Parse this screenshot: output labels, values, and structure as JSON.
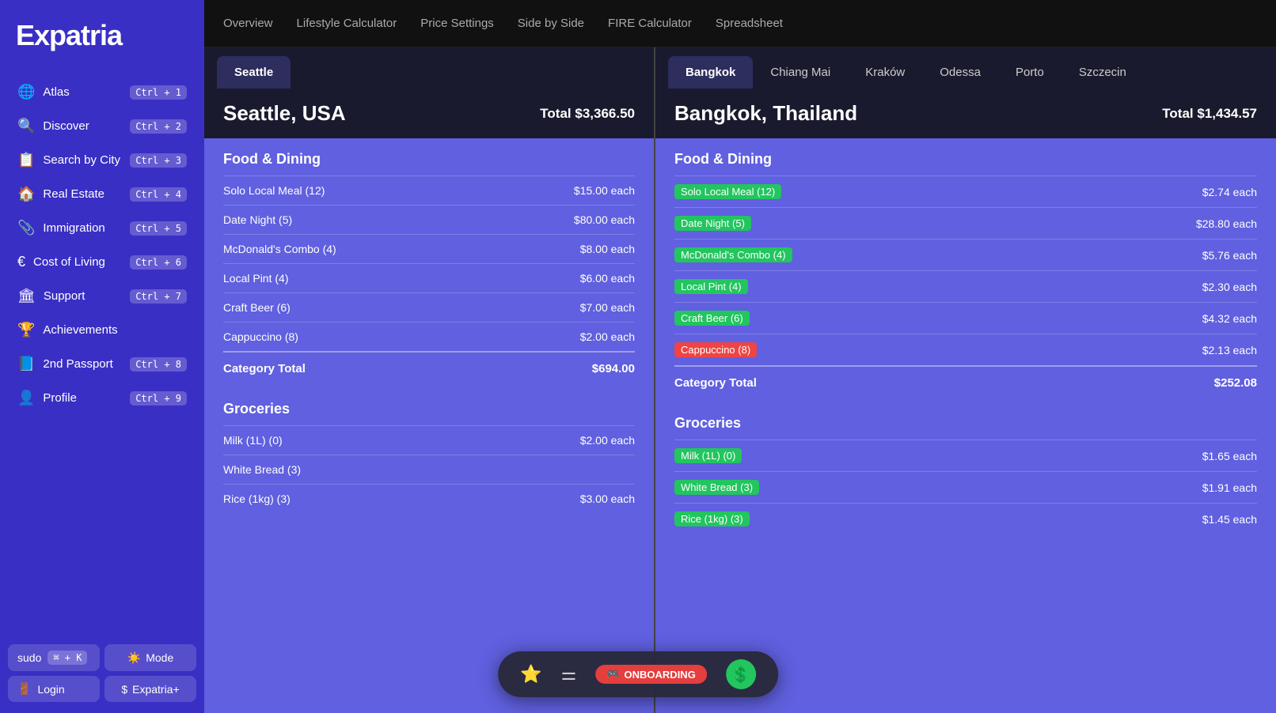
{
  "sidebar": {
    "logo": "Expatria",
    "items": [
      {
        "id": "atlas",
        "icon": "🌐",
        "label": "Atlas",
        "shortcut": "Ctrl + 1"
      },
      {
        "id": "discover",
        "icon": "🔍",
        "label": "Discover",
        "shortcut": "Ctrl + 2"
      },
      {
        "id": "search-by-city",
        "icon": "📋",
        "label": "Search by City",
        "shortcut": "Ctrl + 3"
      },
      {
        "id": "real-estate",
        "icon": "🏠",
        "label": "Real Estate",
        "shortcut": "Ctrl + 4"
      },
      {
        "id": "immigration",
        "icon": "📎",
        "label": "Immigration",
        "shortcut": "Ctrl + 5"
      },
      {
        "id": "cost-of-living",
        "icon": "€",
        "label": "Cost of Living",
        "shortcut": "Ctrl + 6"
      },
      {
        "id": "support",
        "icon": "🏛",
        "label": "Support",
        "shortcut": "Ctrl + 7"
      },
      {
        "id": "achievements",
        "icon": "🏆",
        "label": "Achievements",
        "shortcut": ""
      },
      {
        "id": "2nd-passport",
        "icon": "📘",
        "label": "2nd Passport",
        "shortcut": "Ctrl + 8"
      },
      {
        "id": "profile",
        "icon": "👤",
        "label": "Profile",
        "shortcut": "Ctrl + 9"
      }
    ],
    "sudo_label": "sudo",
    "sudo_shortcut": "⌘ + K",
    "mode_label": "Mode",
    "login_label": "Login",
    "expatria_plus_label": "Expatria+"
  },
  "top_nav": {
    "items": [
      {
        "id": "overview",
        "label": "Overview"
      },
      {
        "id": "lifestyle-calc",
        "label": "Lifestyle Calculator"
      },
      {
        "id": "price-settings",
        "label": "Price Settings"
      },
      {
        "id": "side-by-side",
        "label": "Side by Side"
      },
      {
        "id": "fire-calc",
        "label": "FIRE Calculator"
      },
      {
        "id": "spreadsheet",
        "label": "Spreadsheet"
      }
    ]
  },
  "left_panel": {
    "tab_label": "Seattle",
    "city_name": "Seattle, USA",
    "city_total": "Total $3,366.50",
    "sections": [
      {
        "title": "Food & Dining",
        "rows": [
          {
            "label": "Solo Local Meal (12)",
            "value": "$15.00 each",
            "tag": null
          },
          {
            "label": "Date Night (5)",
            "value": "$80.00 each",
            "tag": null
          },
          {
            "label": "McDonald's Combo (4)",
            "value": "$8.00 each",
            "tag": null
          },
          {
            "label": "Local Pint (4)",
            "value": "$6.00 each",
            "tag": null
          },
          {
            "label": "Craft Beer (6)",
            "value": "$7.00 each",
            "tag": null
          },
          {
            "label": "Cappuccino (8)",
            "value": "$2.00 each",
            "tag": null
          }
        ],
        "category_total_label": "Category Total",
        "category_total_value": "$694.00"
      },
      {
        "title": "Groceries",
        "rows": [
          {
            "label": "Milk (1L) (0)",
            "value": "$2.00 each",
            "tag": null
          },
          {
            "label": "White Bread (3)",
            "value": "",
            "tag": null
          },
          {
            "label": "Rice (1kg) (3)",
            "value": "$3.00 each",
            "tag": null
          }
        ],
        "category_total_label": "",
        "category_total_value": ""
      }
    ]
  },
  "right_panel": {
    "tabs": [
      {
        "id": "bangkok",
        "label": "Bangkok",
        "active": true
      },
      {
        "id": "chiang-mai",
        "label": "Chiang Mai"
      },
      {
        "id": "krakow",
        "label": "Kraków"
      },
      {
        "id": "odessa",
        "label": "Odessa"
      },
      {
        "id": "porto",
        "label": "Porto"
      },
      {
        "id": "szczecin",
        "label": "Szczecin"
      }
    ],
    "city_name": "Bangkok, Thailand",
    "city_total": "Total $1,434.57",
    "sections": [
      {
        "title": "Food & Dining",
        "rows": [
          {
            "label": "Solo Local Meal (12)",
            "value": "$2.74 each",
            "tag": "green"
          },
          {
            "label": "Date Night (5)",
            "value": "$28.80 each",
            "tag": "green"
          },
          {
            "label": "McDonald's Combo (4)",
            "value": "$5.76 each",
            "tag": "green"
          },
          {
            "label": "Local Pint (4)",
            "value": "$2.30 each",
            "tag": "green"
          },
          {
            "label": "Craft Beer (6)",
            "value": "$4.32 each",
            "tag": "green"
          },
          {
            "label": "Cappuccino (8)",
            "value": "$2.13 each",
            "tag": "red"
          }
        ],
        "category_total_label": "Category Total",
        "category_total_value": "$252.08"
      },
      {
        "title": "Groceries",
        "rows": [
          {
            "label": "Milk (1L) (0)",
            "value": "$1.65 each",
            "tag": "green"
          },
          {
            "label": "White Bread (3)",
            "value": "$1.91 each",
            "tag": "green"
          },
          {
            "label": "Rice (1kg) (3)",
            "value": "$1.45 each",
            "tag": "green"
          }
        ],
        "category_total_label": "",
        "category_total_value": ""
      }
    ]
  },
  "bottom_bar": {
    "star_icon": "⭐",
    "bars_icon": "☰",
    "onboarding_label": "ONBOARDING",
    "dollar_icon": "💲"
  }
}
